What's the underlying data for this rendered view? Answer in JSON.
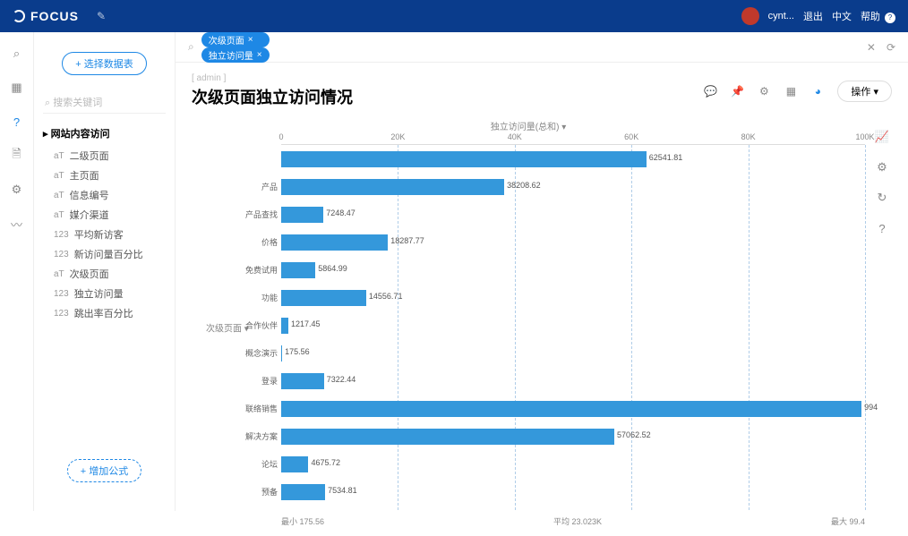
{
  "header": {
    "brand": "FOCUS",
    "user": "cynt...",
    "logout": "退出",
    "lang": "中文",
    "help": "帮助"
  },
  "sidebar": {
    "select_btn": "+ 选择数据表",
    "search_placeholder": "搜索关键词",
    "tree_title": "网站内容访问",
    "items": [
      {
        "icon": "T",
        "label": "二级页面"
      },
      {
        "icon": "T",
        "label": "主页面"
      },
      {
        "icon": "T",
        "label": "信息编号"
      },
      {
        "icon": "T",
        "label": "媒介渠道"
      },
      {
        "icon": "#",
        "label": "平均新访客"
      },
      {
        "icon": "#",
        "label": "新访问量百分比"
      },
      {
        "icon": "T",
        "label": "次级页面"
      },
      {
        "icon": "#",
        "label": "独立访问量"
      },
      {
        "icon": "#",
        "label": "跳出率百分比"
      }
    ],
    "formula_btn": "+ 增加公式"
  },
  "query": {
    "pills": [
      "次级页面",
      "独立访问量"
    ]
  },
  "page": {
    "breadcrumb": "[ admin ]",
    "title": "次级页面独立访问情况",
    "op_btn": "操作"
  },
  "chart_data": {
    "type": "bar",
    "orientation": "horizontal",
    "x_title": "独立访问量(总和)",
    "y_title": "次级页面",
    "x_ticks": [
      0,
      20000,
      40000,
      60000,
      80000,
      100000
    ],
    "x_tick_labels": [
      "0",
      "20K",
      "40K",
      "60K",
      "80K",
      "100K"
    ],
    "xlim": [
      0,
      100000
    ],
    "categories": [
      "",
      "产品",
      "产品查找",
      "价格",
      "免费试用",
      "功能",
      "合作伙伴",
      "概念演示",
      "登录",
      "联络销售",
      "解决方案",
      "论坛",
      "预备"
    ],
    "values": [
      62541.81,
      38208.62,
      7248.47,
      18287.77,
      5864.99,
      14556.71,
      1217.45,
      175.56,
      7322.44,
      99400,
      57062.52,
      4675.72,
      7534.81
    ],
    "value_labels": [
      "62541.81",
      "38208.62",
      "7248.47",
      "18287.77",
      "5864.99",
      "14556.71",
      "1217.45",
      "175.56",
      "7322.44",
      "994",
      "57062.52",
      "4675.72",
      "7534.81"
    ],
    "stats": {
      "min": "最小 175.56",
      "avg": "平均 23.023K",
      "max": "最大 99.4"
    }
  }
}
